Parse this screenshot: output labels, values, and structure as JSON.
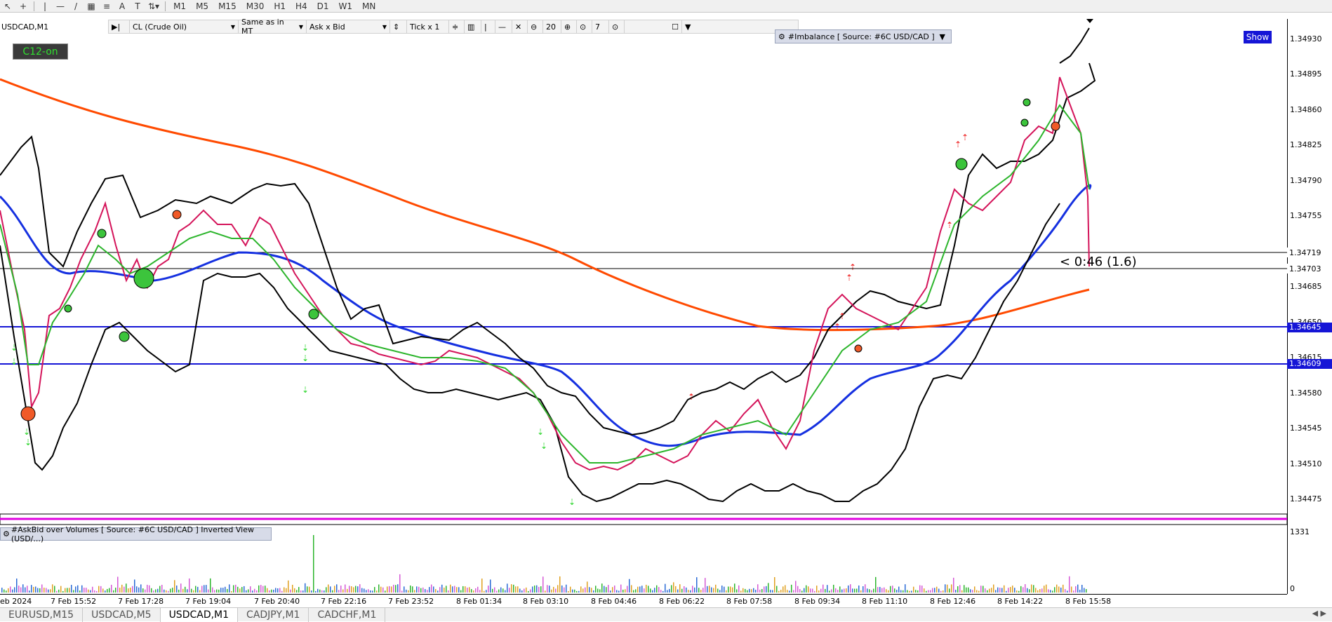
{
  "toolbar": {
    "timeframes": [
      "M1",
      "M5",
      "M15",
      "M30",
      "H1",
      "H4",
      "D1",
      "W1",
      "MN"
    ]
  },
  "chart": {
    "symbol": "USDCAD,M1",
    "instrument": "CL (Crude Oil)",
    "scale_mode": "Same as in MT",
    "price_mode": "Ask x Bid",
    "tick_mode": "Tick x 1",
    "zoom_value": "20",
    "depth_value": "7",
    "c12_label": "C12-on",
    "imbalance_label": "#Imbalance [ Source: #6C USD/CAD ]",
    "show_label": "Show",
    "timer_text": "< 0:46 (1.6)",
    "subwindow_label": "#AskBid over Volumes [ Source: #6C USD/CAD ] Inverted View (USD/...)",
    "sub_max": "1331",
    "sub_min": "0"
  },
  "price_axis": {
    "labels": [
      "1.34930",
      "1.34895",
      "1.34860",
      "1.34825",
      "1.34790",
      "1.34755",
      "1.34685",
      "1.34650",
      "1.34615",
      "1.34580",
      "1.34545",
      "1.34510",
      "1.34475"
    ],
    "tags": [
      {
        "value": "1.34719",
        "color": "#000000",
        "bg": "#ffffff"
      },
      {
        "value": "1.34703",
        "color": "#000000",
        "bg": "#ffffff"
      },
      {
        "value": "1.34645",
        "color": "#ffffff",
        "bg": "#1515d6"
      },
      {
        "value": "1.34609",
        "color": "#ffffff",
        "bg": "#1515d6"
      }
    ]
  },
  "time_axis": {
    "labels": [
      "eb 2024",
      "7 Feb 15:52",
      "7 Feb 17:28",
      "7 Feb 19:04",
      "7 Feb 20:40",
      "7 Feb 22:16",
      "7 Feb 23:52",
      "8 Feb 01:34",
      "8 Feb 03:10",
      "8 Feb 04:46",
      "8 Feb 06:22",
      "8 Feb 07:58",
      "8 Feb 09:34",
      "8 Feb 11:10",
      "8 Feb 12:46",
      "8 Feb 14:22",
      "8 Feb 15:58"
    ]
  },
  "tabs": [
    {
      "label": "EURUSD,M15",
      "active": false
    },
    {
      "label": "USDCAD,M5",
      "active": false
    },
    {
      "label": "USDCAD,M1",
      "active": true
    },
    {
      "label": "CADJPY,M1",
      "active": false
    },
    {
      "label": "CADCHF,M1",
      "active": false
    }
  ],
  "colors": {
    "upper_blue_line": "#1515d6",
    "ma_orange": "#ff4a00",
    "ma_blue": "#1530e0",
    "bollinger": "#000000",
    "price": "#d4145a",
    "green_ma": "#2cb52c"
  }
}
